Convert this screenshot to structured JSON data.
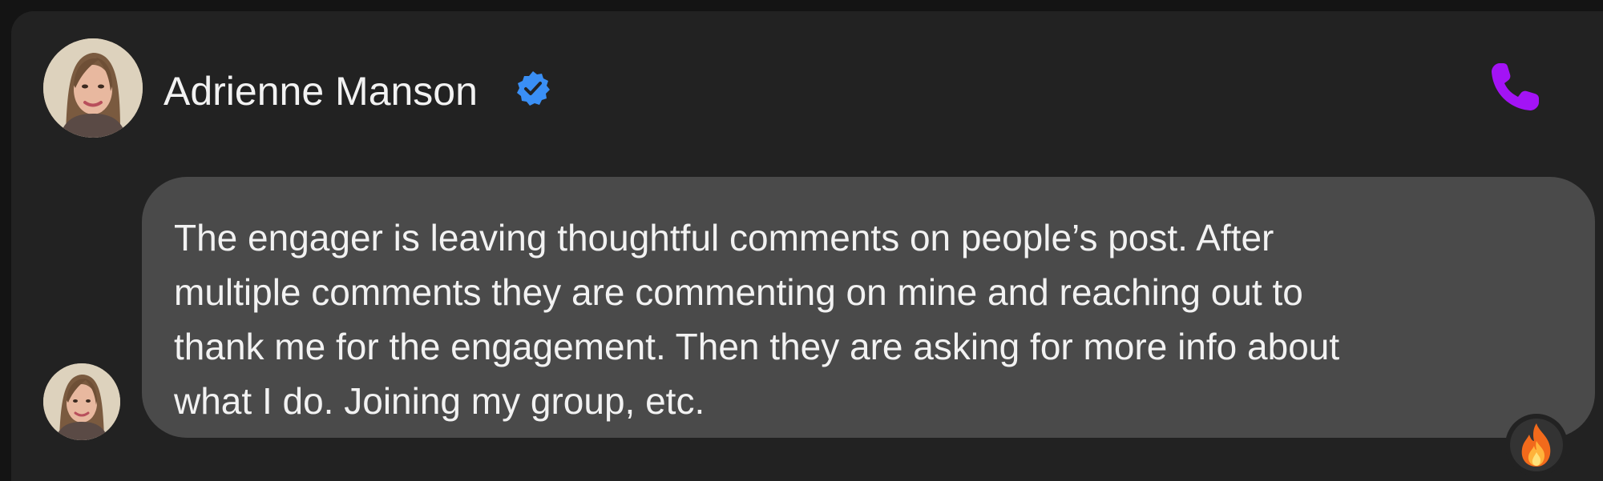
{
  "contact": {
    "name": "Adrienne Manson",
    "verified": true
  },
  "icons": {
    "verified": "verified-badge-icon",
    "call": "phone-icon",
    "reaction": "fire-emoji"
  },
  "colors": {
    "verified_badge": "#3a8ff5",
    "call_icon": "#a313f5",
    "bubble_background": "#4a4a4a"
  },
  "message": {
    "text": "The engager is leaving thoughtful comments on people’s post. After\nmultiple comments they are commenting on mine and reaching out to\nthank me for the engagement. Then they are asking for more info about\nwhat I do. Joining my group, etc.",
    "reaction": "🔥"
  }
}
